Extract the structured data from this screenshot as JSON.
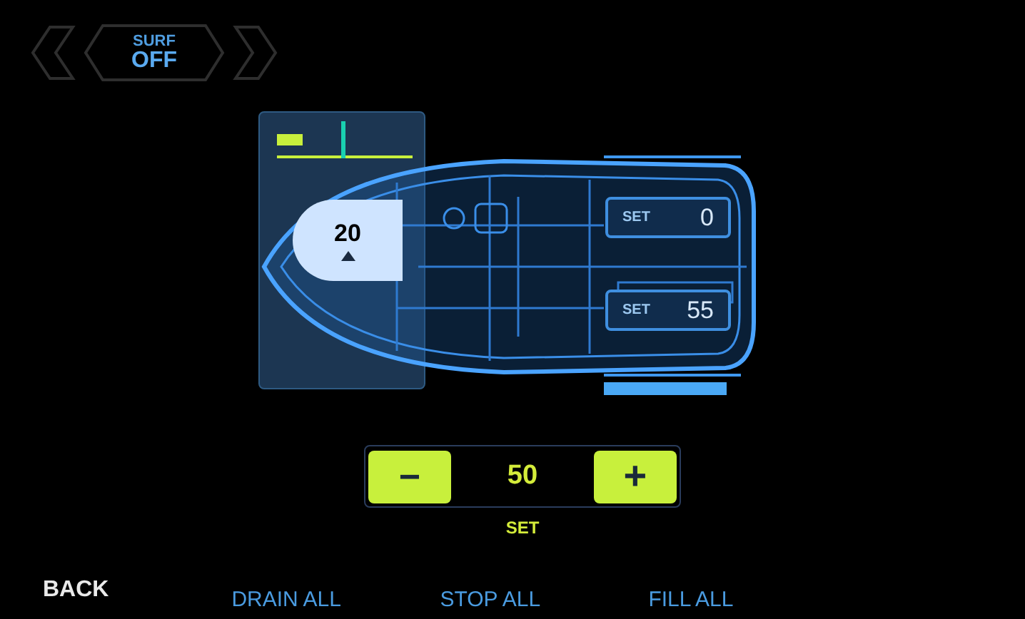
{
  "mode_selector": {
    "label": "SURF",
    "value": "OFF"
  },
  "front_tank": {
    "value": "20",
    "level": 0.48
  },
  "rear_tanks": [
    {
      "label": "SET",
      "value": "0"
    },
    {
      "label": "SET",
      "value": "55",
      "level": 0.9
    }
  ],
  "stepper": {
    "minus": "−",
    "value": "50",
    "plus": "+",
    "caption": "SET"
  },
  "back": "BACK",
  "actions": [
    "DRAIN ALL",
    "STOP ALL",
    "FILL ALL"
  ]
}
